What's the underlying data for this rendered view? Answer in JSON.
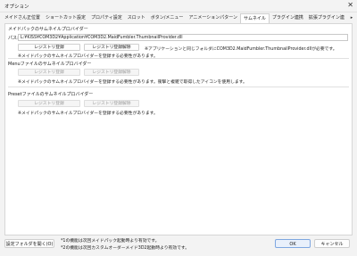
{
  "window": {
    "title": "オプション",
    "close_glyph": "✕"
  },
  "tabs": [
    {
      "label": "メイドさん正位置",
      "active": false
    },
    {
      "label": "ショートカット設定",
      "active": false
    },
    {
      "label": "プロパティ設定",
      "active": false
    },
    {
      "label": "スロット",
      "active": false
    },
    {
      "label": "ボタン/メニュー",
      "active": false
    },
    {
      "label": "アニメーションパターン",
      "active": false
    },
    {
      "label": "サムネイル",
      "active": true
    },
    {
      "label": "プラグイン連携",
      "active": false
    },
    {
      "label": "拡張プラグイン連",
      "active": false
    }
  ],
  "tab_scroll_glyph": "▸",
  "section1": {
    "title": "メイドパックのサムネイルプロバイダー",
    "path_label": "パス:",
    "path_value": "L:¥KISS¥COM3D2¥Application¥COM3D2.MaidFumbler.ThumbnailProvider.dll",
    "register_button": "レジストリ登録",
    "unregister_button": "レジストリ登録解除",
    "note": "※アプリケーションと同じフォルダにCOM3D2.MaidFumbler.ThumbnailProvider.dllが必要です。",
    "note2": "※メイドパックのサムネイルプロバイダーを登録する必要性があります。"
  },
  "section2": {
    "title": "Menuファイルのサムネイルプロバイダー",
    "register_button": "レジストリ登録",
    "unregister_button": "レジストリ登録解除",
    "note": "※メイドパックのサムネイルプロバイダーを登録する必要性があります。衝撃と複雑で取得したアイコンを使用します。"
  },
  "section3": {
    "title": "Presetファイルのサムネイルプロバイダー",
    "register_button": "レジストリ登録",
    "unregister_button": "レジストリ登録解除",
    "note": "※メイドパックのサムネイルプロバイダーを登録する必要性があります。"
  },
  "footer": {
    "settings_folder_button": "設定フォルダを開く(O)",
    "note_line1": "*1の機能は次回メイドパック起動時より有効です。",
    "note_line2": "*2の機能は次回カスタムオーダーメイド3D2起動時より有効です。",
    "ok_button": "OK",
    "cancel_button": "キャンセル"
  }
}
